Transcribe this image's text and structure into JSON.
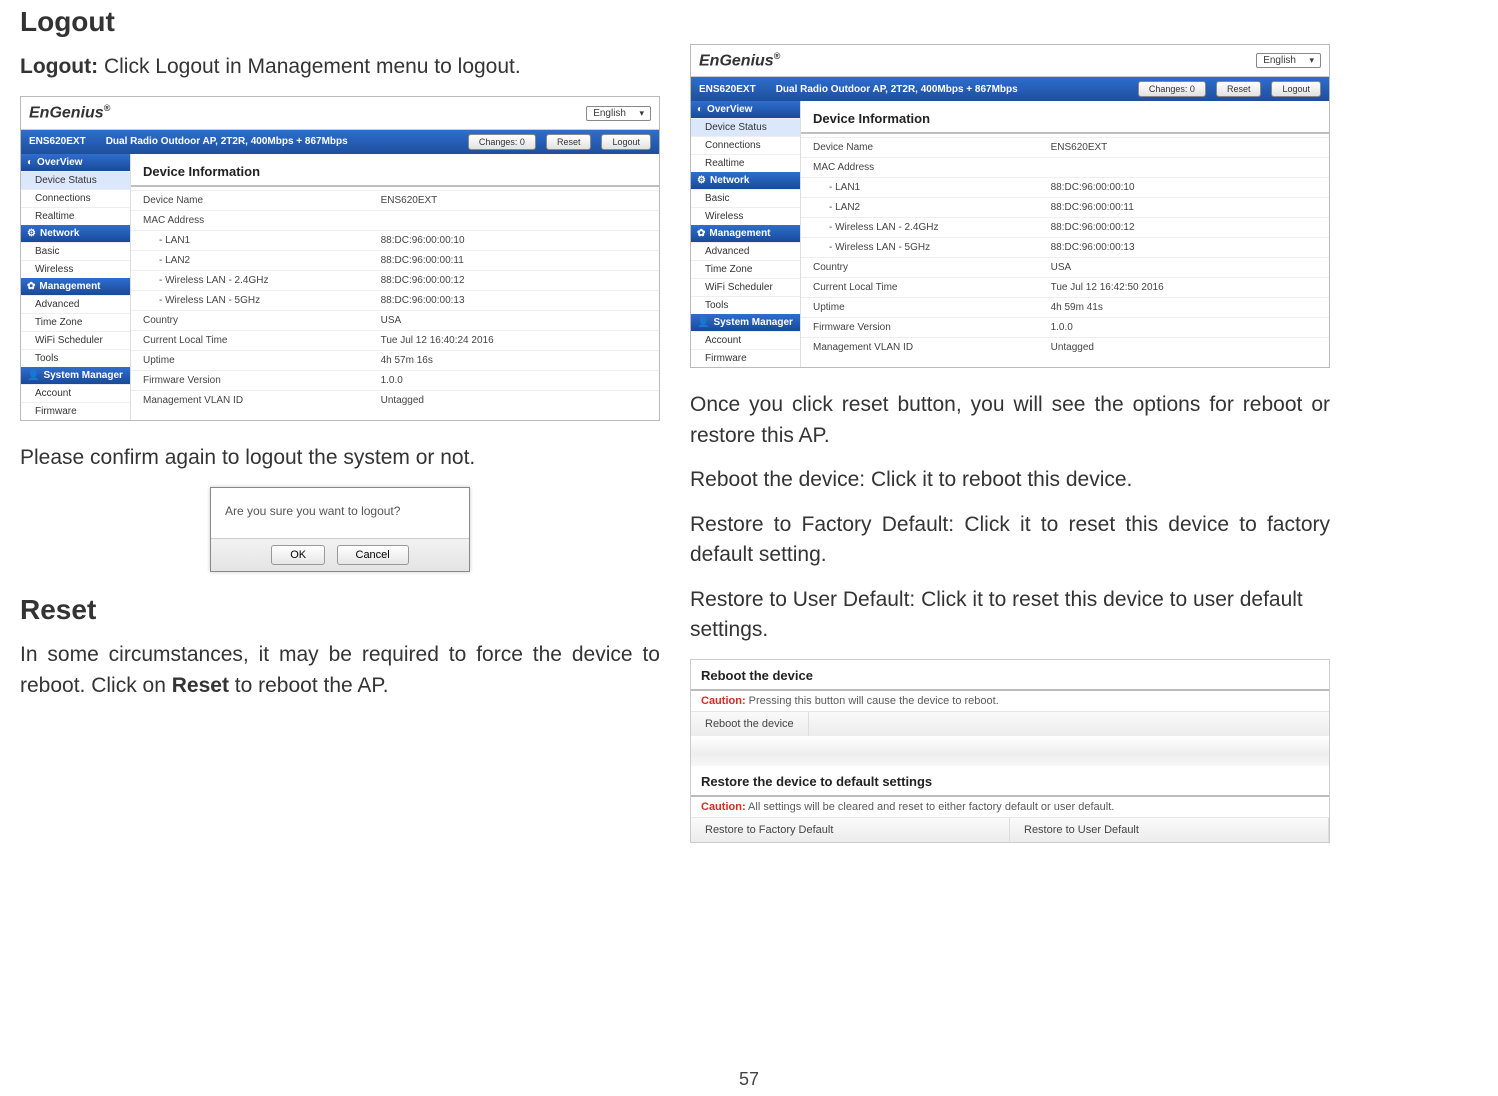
{
  "page_number": "57",
  "left": {
    "heading_logout": "Logout",
    "logout_intro_bold": "Logout:",
    "logout_intro_rest": " Click Logout  in Management menu to logout.",
    "confirm_text": "Please confirm again to logout the system or not.",
    "heading_reset": "Reset",
    "reset_para_a": "In some circumstances, it may be required to force the device to reboot. Click on ",
    "reset_para_bold": "Reset",
    "reset_para_b": " to reboot the AP."
  },
  "right": {
    "p1": "Once you click reset button, you will see the options for reboot or restore this AP.",
    "p2": "Reboot the device: Click it to reboot this device.",
    "p3": "Restore to Factory Default: Click it to reset this device to factory default setting.",
    "p4": "Restore to User Default: Click it to reset this device to user default settings."
  },
  "router1": {
    "brand": "EnGenius",
    "lang": "English",
    "model": "ENS620EXT",
    "desc": "Dual Radio Outdoor AP, 2T2R, 400Mbps + 867Mbps",
    "changes": "Changes: 0",
    "reset": "Reset",
    "logout": "Logout",
    "sidebar": {
      "overview": "OverView",
      "device_status": "Device Status",
      "connections": "Connections",
      "realtime": "Realtime",
      "network": "Network",
      "basic": "Basic",
      "wireless": "Wireless",
      "management": "Management",
      "advanced": "Advanced",
      "timezone": "Time Zone",
      "wifi_scheduler": "WiFi Scheduler",
      "tools": "Tools",
      "system_manager": "System Manager",
      "account": "Account",
      "firmware": "Firmware"
    },
    "content_title": "Device Information",
    "rows": [
      {
        "k": "Device Name",
        "v": "ENS620EXT"
      },
      {
        "k": "MAC Address",
        "v": ""
      },
      {
        "k": "- LAN1",
        "v": "88:DC:96:00:00:10",
        "indent": true
      },
      {
        "k": "- LAN2",
        "v": "88:DC:96:00:00:11",
        "indent": true
      },
      {
        "k": "- Wireless LAN - 2.4GHz",
        "v": "88:DC:96:00:00:12",
        "indent": true
      },
      {
        "k": "- Wireless LAN - 5GHz",
        "v": "88:DC:96:00:00:13",
        "indent": true
      },
      {
        "k": "Country",
        "v": "USA"
      },
      {
        "k": "Current Local Time",
        "v": "Tue Jul 12 16:40:24 2016"
      },
      {
        "k": "Uptime",
        "v": "4h 57m 16s"
      },
      {
        "k": "Firmware Version",
        "v": "1.0.0"
      },
      {
        "k": "Management VLAN ID",
        "v": "Untagged"
      }
    ]
  },
  "router2": {
    "brand": "EnGenius",
    "lang": "English",
    "model": "ENS620EXT",
    "desc": "Dual Radio Outdoor AP, 2T2R, 400Mbps + 867Mbps",
    "changes": "Changes: 0",
    "reset": "Reset",
    "logout": "Logout",
    "content_title": "Device Information",
    "rows": [
      {
        "k": "Device Name",
        "v": "ENS620EXT"
      },
      {
        "k": "MAC Address",
        "v": ""
      },
      {
        "k": "- LAN1",
        "v": "88:DC:96:00:00:10",
        "indent": true
      },
      {
        "k": "- LAN2",
        "v": "88:DC:96:00:00:11",
        "indent": true
      },
      {
        "k": "- Wireless LAN - 2.4GHz",
        "v": "88:DC:96:00:00:12",
        "indent": true
      },
      {
        "k": "- Wireless LAN - 5GHz",
        "v": "88:DC:96:00:00:13",
        "indent": true
      },
      {
        "k": "Country",
        "v": "USA"
      },
      {
        "k": "Current Local Time",
        "v": "Tue Jul 12 16:42:50 2016"
      },
      {
        "k": "Uptime",
        "v": "4h 59m 41s"
      },
      {
        "k": "Firmware Version",
        "v": "1.0.0"
      },
      {
        "k": "Management VLAN ID",
        "v": "Untagged"
      }
    ]
  },
  "dialog": {
    "msg": "Are you sure you want to logout?",
    "ok": "OK",
    "cancel": "Cancel"
  },
  "reset_block": {
    "h1": "Reboot the device",
    "caution_label": "Caution:",
    "c1": " Pressing this button will cause the device to reboot.",
    "btn1": "Reboot the device",
    "h2": "Restore the device to default settings",
    "c2": " All settings will be cleared and reset to either factory default or user default.",
    "btn2a": "Restore to Factory Default",
    "btn2b": "Restore to User Default"
  }
}
